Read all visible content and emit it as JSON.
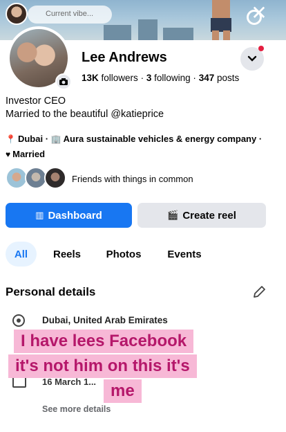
{
  "story": {
    "pill_text": "Current vibe..."
  },
  "profile": {
    "name": "Lee Andrews",
    "followers": "13K",
    "followers_label": "followers",
    "following": "3",
    "following_label": "following",
    "posts": "347",
    "posts_label": "posts",
    "sep": "·",
    "bio_line1": "Investor CEO",
    "bio_line2": "Married to the beautiful @katieprice",
    "location": "Dubai",
    "work": "Aura sustainable vehicles & energy company",
    "relationship": "Married",
    "friends_text": "Friends with things in common"
  },
  "actions": {
    "dashboard": "Dashboard",
    "create_reel": "Create reel"
  },
  "tabs": [
    {
      "label": "All",
      "active": true
    },
    {
      "label": "Reels",
      "active": false
    },
    {
      "label": "Photos",
      "active": false
    },
    {
      "label": "Events",
      "active": false
    }
  ],
  "details": {
    "title": "Personal details",
    "location_full": "Dubai, United Arab Emirates",
    "birthday": "16 March 1...",
    "see_more": "See more details"
  },
  "caption": {
    "line1": "I have lees Facebook",
    "line2": "it's not him on this it's",
    "line3": "me"
  },
  "colors": {
    "primary_blue": "#1877f2",
    "caption_bg": "#f7b8d6",
    "caption_text": "#b5176a",
    "notification_red": "#e41e3f"
  },
  "icons": {
    "camera": "camera-icon",
    "dropdown": "chevron-down-icon",
    "location": "location-pin-icon",
    "work": "briefcase-icon",
    "relationship": "hearts-icon",
    "dashboard": "chart-icon",
    "reel": "reel-icon",
    "edit": "pencil-icon",
    "close": "close-icon"
  }
}
